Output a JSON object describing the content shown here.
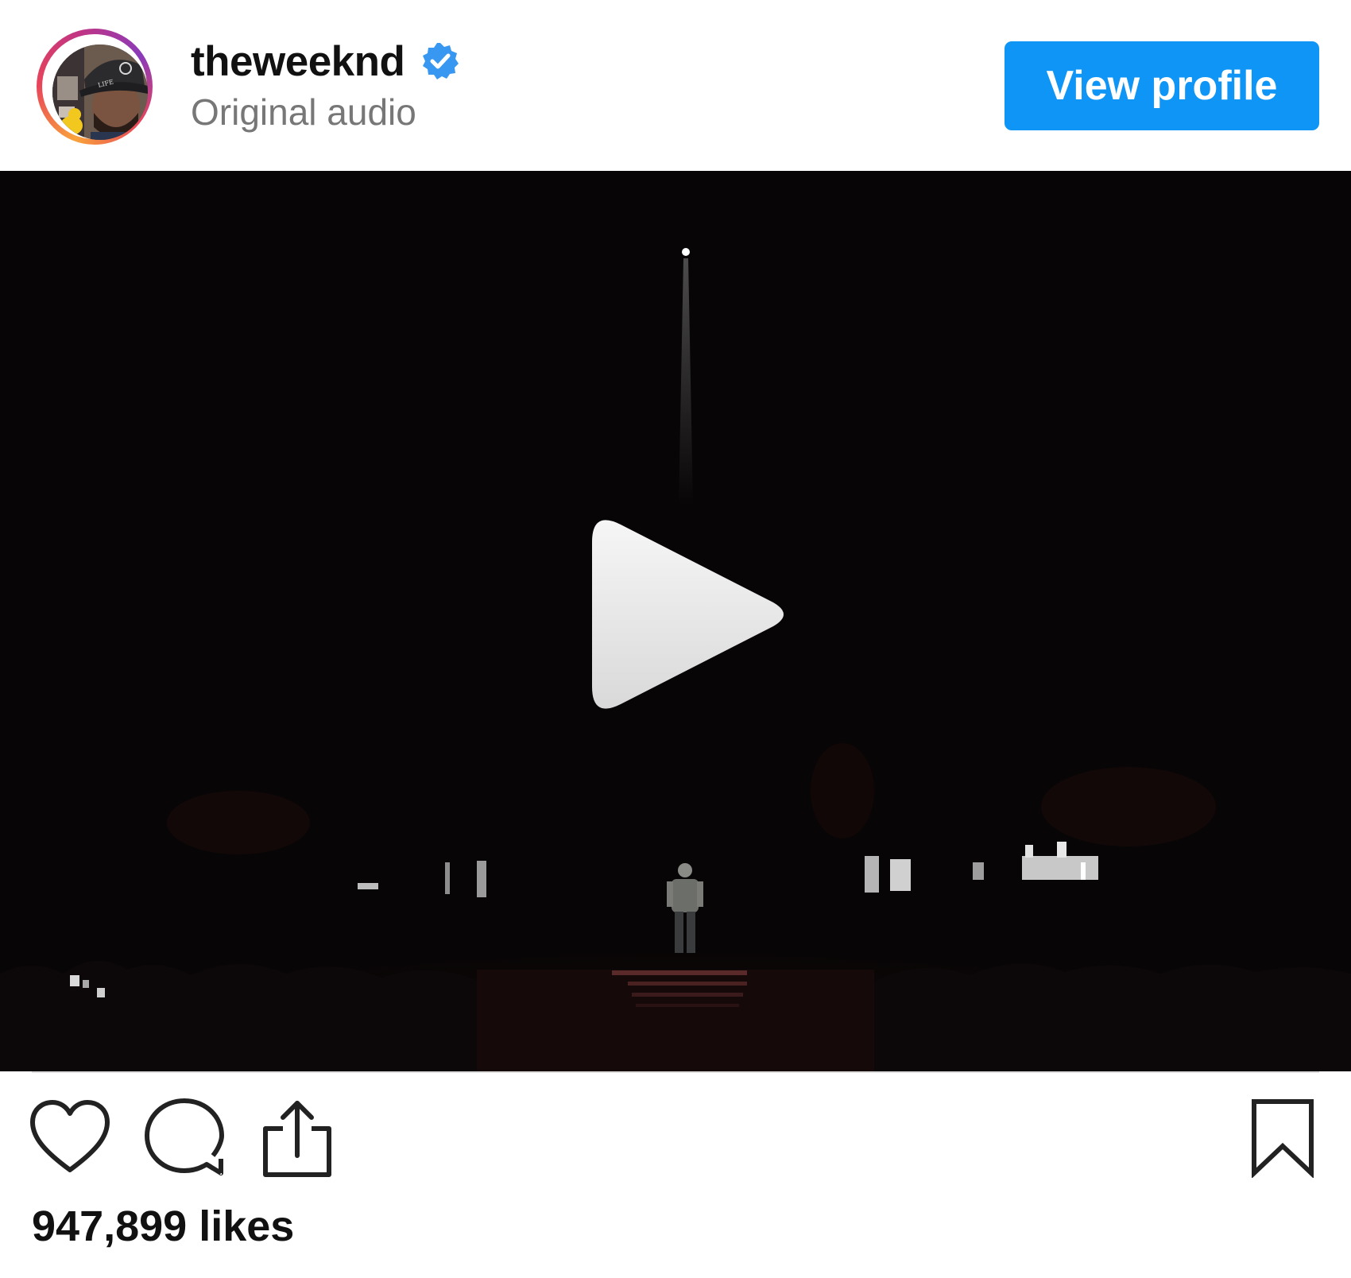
{
  "header": {
    "username": "theweeknd",
    "verified": true,
    "audio_label": "Original audio",
    "view_profile_label": "View profile"
  },
  "colors": {
    "accent_button": "#0f95f6",
    "verified_badge": "#3897f0",
    "secondary_text": "#777777",
    "video_background": "#070506"
  },
  "video": {
    "state": "paused",
    "play_icon": "play-icon"
  },
  "actions": {
    "like_icon": "heart-icon",
    "comment_icon": "comment-icon",
    "share_icon": "share-icon",
    "save_icon": "bookmark-icon"
  },
  "engagement": {
    "likes_text": "947,899 likes"
  }
}
